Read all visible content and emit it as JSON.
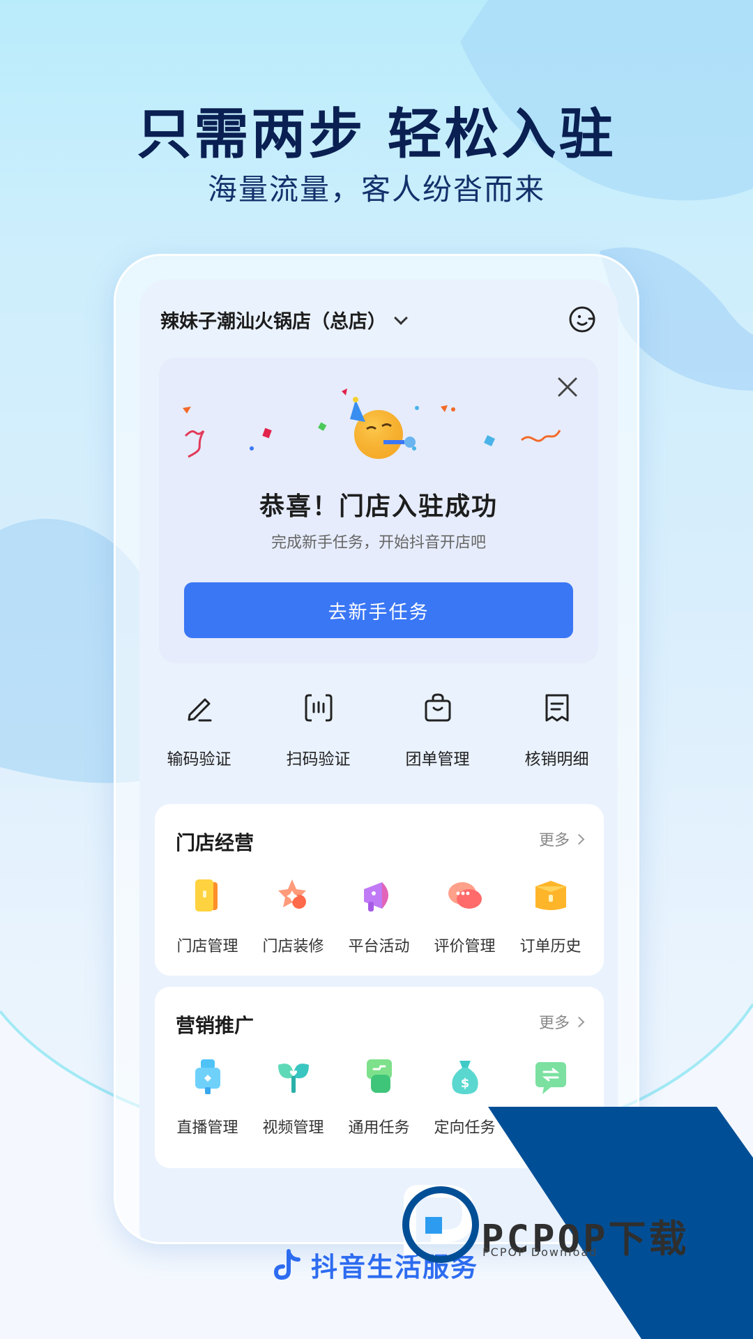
{
  "headline": "只需两步  轻松入驻",
  "subline": "海量流量，客人纷沓而来",
  "store": {
    "name": "辣妹子潮汕火锅店（总店）"
  },
  "success_card": {
    "title": "恭喜！门店入驻成功",
    "subtitle": "完成新手任务，开始抖音开店吧",
    "button_label": "去新手任务"
  },
  "quick_actions": [
    {
      "label": "输码验证",
      "icon": "pencil-icon"
    },
    {
      "label": "扫码验证",
      "icon": "scan-icon"
    },
    {
      "label": "团单管理",
      "icon": "shopping-bag-icon"
    },
    {
      "label": "核销明细",
      "icon": "receipt-icon"
    }
  ],
  "store_ops": {
    "title": "门店经营",
    "more": "更多",
    "items": [
      {
        "label": "门店管理",
        "icon": "store-icon"
      },
      {
        "label": "门店装修",
        "icon": "decoration-icon"
      },
      {
        "label": "平台活动",
        "icon": "megaphone-icon"
      },
      {
        "label": "评价管理",
        "icon": "comment-icon"
      },
      {
        "label": "订单历史",
        "icon": "order-icon"
      }
    ]
  },
  "marketing": {
    "title": "营销推广",
    "more": "更多",
    "items": [
      {
        "label": "直播管理",
        "icon": "live-icon"
      },
      {
        "label": "视频管理",
        "icon": "video-icon"
      },
      {
        "label": "通用任务",
        "icon": "task-icon"
      },
      {
        "label": "定向任务",
        "icon": "money-bag-icon"
      },
      {
        "label": "",
        "icon": "exchange-icon"
      }
    ]
  },
  "footer": {
    "brand": "抖音生活服务"
  },
  "watermark": {
    "text": "PCPOP下载",
    "sub": "PCPOP Download"
  },
  "colors": {
    "accent": "#3a77f5",
    "title": "#0a1f52",
    "watermark": "#004f96"
  }
}
